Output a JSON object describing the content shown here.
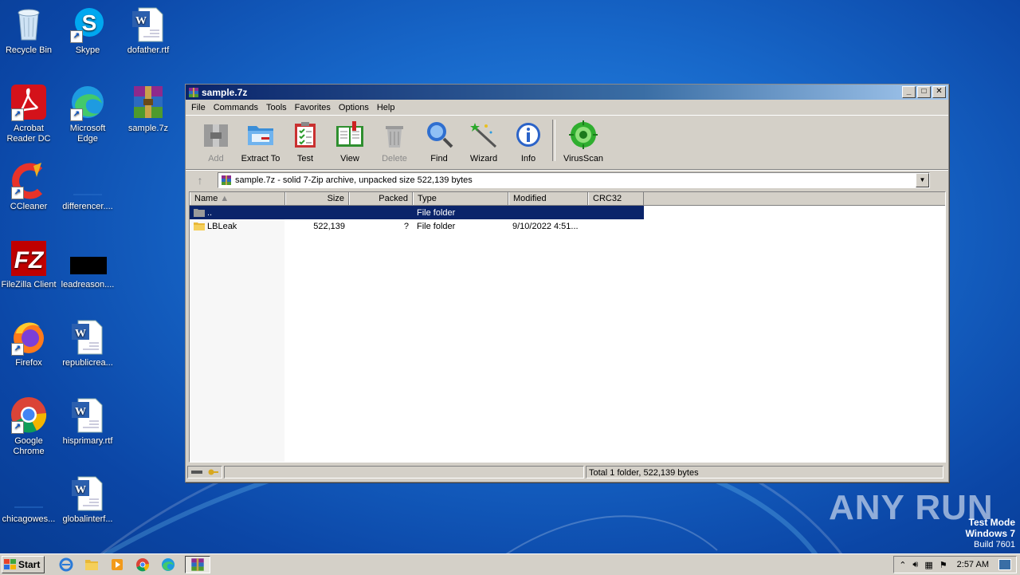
{
  "desktop": {
    "icons": [
      {
        "label": "Recycle Bin",
        "icon": "recycle-bin-icon"
      },
      {
        "label": "Skype",
        "icon": "skype-icon"
      },
      {
        "label": "dofather.rtf",
        "icon": "word-doc-icon"
      },
      {
        "label": "Acrobat Reader DC",
        "icon": "acrobat-icon"
      },
      {
        "label": "Microsoft Edge",
        "icon": "edge-icon"
      },
      {
        "label": "sample.7z",
        "icon": "winrar-archive-icon"
      },
      {
        "label": "CCleaner",
        "icon": "ccleaner-icon"
      },
      {
        "label": "differencer....",
        "icon": "blank-file-icon"
      },
      {
        "label": "FileZilla Client",
        "icon": "filezilla-icon"
      },
      {
        "label": "leadreason....",
        "icon": "black-thumbnail-icon"
      },
      {
        "label": "Firefox",
        "icon": "firefox-icon"
      },
      {
        "label": "republicrea...",
        "icon": "word-doc-icon"
      },
      {
        "label": "Google Chrome",
        "icon": "chrome-icon"
      },
      {
        "label": "hisprimary.rtf",
        "icon": "word-doc-icon"
      },
      {
        "label": "chicagowes...",
        "icon": "blank-file-icon"
      },
      {
        "label": "globalinterf...",
        "icon": "word-doc-icon"
      }
    ]
  },
  "window": {
    "title": "sample.7z",
    "menu": [
      "File",
      "Commands",
      "Tools",
      "Favorites",
      "Options",
      "Help"
    ],
    "toolbar": [
      {
        "label": "Add",
        "icon": "add-archive-icon",
        "enabled": false
      },
      {
        "label": "Extract To",
        "icon": "extract-folder-icon",
        "enabled": true
      },
      {
        "label": "Test",
        "icon": "test-clipboard-icon",
        "enabled": true
      },
      {
        "label": "View",
        "icon": "view-book-icon",
        "enabled": true
      },
      {
        "label": "Delete",
        "icon": "trash-icon",
        "enabled": false
      },
      {
        "label": "Find",
        "icon": "magnifier-icon",
        "enabled": true
      },
      {
        "label": "Wizard",
        "icon": "wand-icon",
        "enabled": true
      },
      {
        "label": "Info",
        "icon": "info-icon",
        "enabled": true
      },
      {
        "label": "VirusScan",
        "icon": "virus-scan-icon",
        "enabled": true
      }
    ],
    "address": "sample.7z - solid 7-Zip archive, unpacked size 522,139 bytes",
    "columns": [
      "Name",
      "Size",
      "Packed",
      "Type",
      "Modified",
      "CRC32"
    ],
    "rows": [
      {
        "name": "..",
        "size": "",
        "packed": "",
        "type": "File folder",
        "modified": "",
        "crc": "",
        "selected": true
      },
      {
        "name": "LBLeak",
        "size": "522,139",
        "packed": "?",
        "type": "File folder",
        "modified": "9/10/2022 4:51...",
        "crc": "",
        "selected": false
      }
    ],
    "status": "Total 1 folder, 522,139 bytes"
  },
  "taskbar": {
    "start_label": "Start",
    "clock": "2:57 AM"
  },
  "watermark": "ANY RUN",
  "testmode": {
    "line1": "Test Mode",
    "line2": "Windows 7",
    "line3": "Build 7601"
  }
}
